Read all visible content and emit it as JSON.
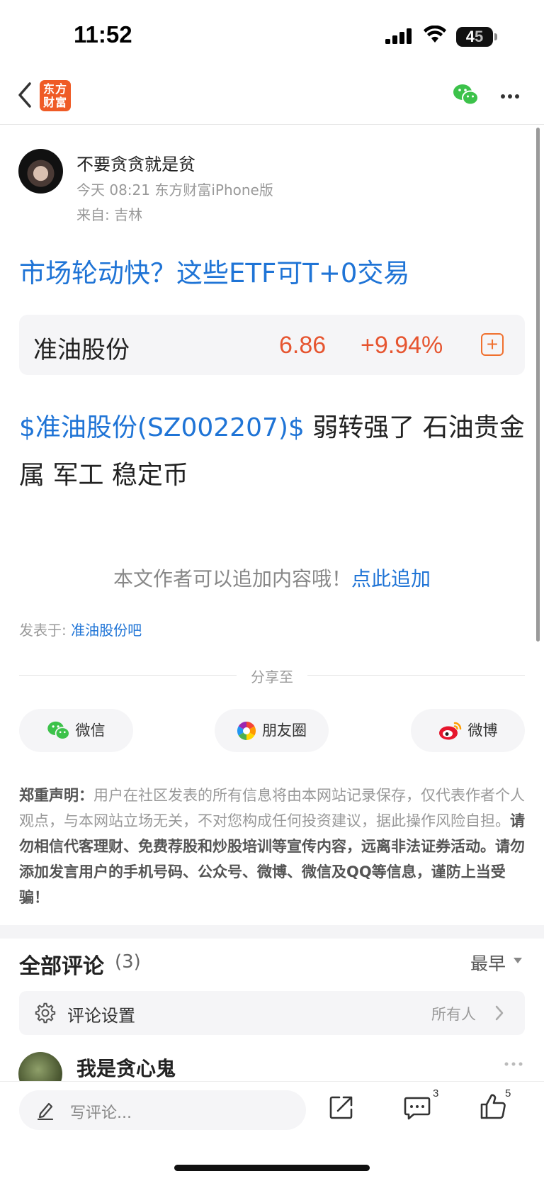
{
  "status_bar": {
    "time": "11:52",
    "battery_level": "45",
    "battery_level_parts": [
      "4",
      "5"
    ]
  },
  "nav": {
    "logo_line1": "东方",
    "logo_line2": "财富"
  },
  "post": {
    "author": "不要贪贪就是贫",
    "meta": "今天 08:21 东方财富iPhone版",
    "from": "来自: 吉林",
    "title": "市场轮动快？这些ETF可T+0交易",
    "stock": {
      "name": "准油股份",
      "price": "6.86",
      "change": "+9.94%",
      "add_symbol": "+"
    },
    "body_link": "$准油股份(SZ002207)$",
    "body_text": "  弱转强了 石油贵金属 军工 稳定币",
    "append_text": "本文作者可以追加内容哦！",
    "append_link": "点此追加",
    "posted_in_label": "发表于: ",
    "posted_in_link": "准油股份吧"
  },
  "share": {
    "label": "分享至",
    "buttons": [
      {
        "label": "微信",
        "icon": "wechat-icon"
      },
      {
        "label": "朋友圈",
        "icon": "moments-icon"
      },
      {
        "label": "微博",
        "icon": "weibo-icon"
      }
    ]
  },
  "disclaimer": {
    "heading": "郑重声明：",
    "normal": "用户在社区发表的所有信息将由本网站记录保存，仅代表作者个人观点，与本网站立场无关，不对您构成任何投资建议，据此操作风险自担。",
    "bold": "请勿相信代客理财、免费荐股和炒股培训等宣传内容，远离非法证券活动。请勿添加发言用户的手机号码、公众号、微博、微信及QQ等信息，谨防上当受骗！"
  },
  "comments": {
    "title": "全部评论",
    "count": "(3)",
    "sort": "最早",
    "settings_label": "评论设置",
    "settings_value": "所有人",
    "first_commenter": "我是贪心鬼"
  },
  "bottom_bar": {
    "input_placeholder": "写评论...",
    "comment_count": "3",
    "like_count": "5"
  },
  "colors": {
    "accent_blue": "#1f74d6",
    "stock_red": "#e65530",
    "brand_orange": "#ef5b26"
  }
}
